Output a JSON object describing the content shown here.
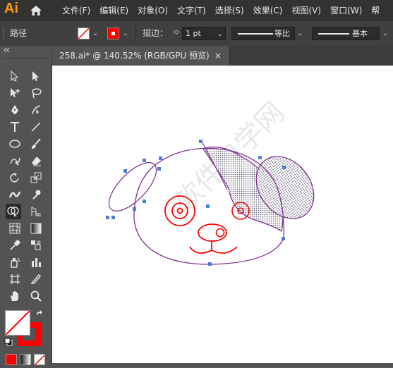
{
  "app": {
    "logo": "Ai"
  },
  "menu": [
    {
      "label": "文件(F)"
    },
    {
      "label": "编辑(E)"
    },
    {
      "label": "对象(O)"
    },
    {
      "label": "文字(T)"
    },
    {
      "label": "选择(S)"
    },
    {
      "label": "效果(C)"
    },
    {
      "label": "视图(V)"
    },
    {
      "label": "窗口(W)"
    },
    {
      "label": "帮"
    }
  ],
  "control_bar": {
    "object_type": "路径",
    "stroke_label": "描边：",
    "stroke_weight": "1 pt",
    "profile_label": "等比",
    "brush_label": "基本",
    "fill_color": "#ffffff",
    "stroke_color": "#ff0000"
  },
  "document": {
    "tab_title": "258.ai* @ 140.52% (RGB/GPU 预览)",
    "close_glyph": "×"
  },
  "watermark": "软件自学网",
  "colors": {
    "path": "#7b2d8e",
    "eye": "#ff0000",
    "anchor": "#4a7fe0"
  }
}
